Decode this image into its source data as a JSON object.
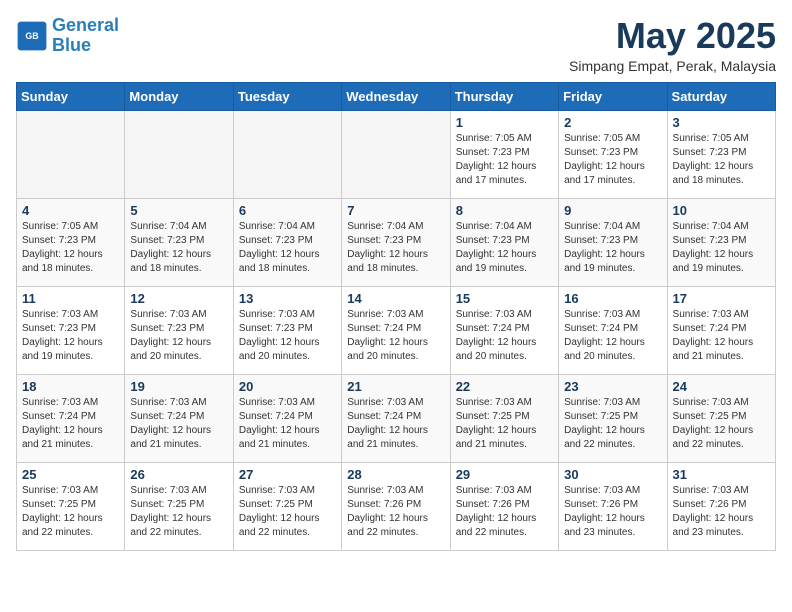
{
  "header": {
    "logo_line1": "General",
    "logo_line2": "Blue",
    "month_title": "May 2025",
    "subtitle": "Simpang Empat, Perak, Malaysia"
  },
  "weekdays": [
    "Sunday",
    "Monday",
    "Tuesday",
    "Wednesday",
    "Thursday",
    "Friday",
    "Saturday"
  ],
  "weeks": [
    [
      {
        "day": "",
        "info": ""
      },
      {
        "day": "",
        "info": ""
      },
      {
        "day": "",
        "info": ""
      },
      {
        "day": "",
        "info": ""
      },
      {
        "day": "1",
        "info": "Sunrise: 7:05 AM\nSunset: 7:23 PM\nDaylight: 12 hours\nand 17 minutes."
      },
      {
        "day": "2",
        "info": "Sunrise: 7:05 AM\nSunset: 7:23 PM\nDaylight: 12 hours\nand 17 minutes."
      },
      {
        "day": "3",
        "info": "Sunrise: 7:05 AM\nSunset: 7:23 PM\nDaylight: 12 hours\nand 18 minutes."
      }
    ],
    [
      {
        "day": "4",
        "info": "Sunrise: 7:05 AM\nSunset: 7:23 PM\nDaylight: 12 hours\nand 18 minutes."
      },
      {
        "day": "5",
        "info": "Sunrise: 7:04 AM\nSunset: 7:23 PM\nDaylight: 12 hours\nand 18 minutes."
      },
      {
        "day": "6",
        "info": "Sunrise: 7:04 AM\nSunset: 7:23 PM\nDaylight: 12 hours\nand 18 minutes."
      },
      {
        "day": "7",
        "info": "Sunrise: 7:04 AM\nSunset: 7:23 PM\nDaylight: 12 hours\nand 18 minutes."
      },
      {
        "day": "8",
        "info": "Sunrise: 7:04 AM\nSunset: 7:23 PM\nDaylight: 12 hours\nand 19 minutes."
      },
      {
        "day": "9",
        "info": "Sunrise: 7:04 AM\nSunset: 7:23 PM\nDaylight: 12 hours\nand 19 minutes."
      },
      {
        "day": "10",
        "info": "Sunrise: 7:04 AM\nSunset: 7:23 PM\nDaylight: 12 hours\nand 19 minutes."
      }
    ],
    [
      {
        "day": "11",
        "info": "Sunrise: 7:03 AM\nSunset: 7:23 PM\nDaylight: 12 hours\nand 19 minutes."
      },
      {
        "day": "12",
        "info": "Sunrise: 7:03 AM\nSunset: 7:23 PM\nDaylight: 12 hours\nand 20 minutes."
      },
      {
        "day": "13",
        "info": "Sunrise: 7:03 AM\nSunset: 7:23 PM\nDaylight: 12 hours\nand 20 minutes."
      },
      {
        "day": "14",
        "info": "Sunrise: 7:03 AM\nSunset: 7:24 PM\nDaylight: 12 hours\nand 20 minutes."
      },
      {
        "day": "15",
        "info": "Sunrise: 7:03 AM\nSunset: 7:24 PM\nDaylight: 12 hours\nand 20 minutes."
      },
      {
        "day": "16",
        "info": "Sunrise: 7:03 AM\nSunset: 7:24 PM\nDaylight: 12 hours\nand 20 minutes."
      },
      {
        "day": "17",
        "info": "Sunrise: 7:03 AM\nSunset: 7:24 PM\nDaylight: 12 hours\nand 21 minutes."
      }
    ],
    [
      {
        "day": "18",
        "info": "Sunrise: 7:03 AM\nSunset: 7:24 PM\nDaylight: 12 hours\nand 21 minutes."
      },
      {
        "day": "19",
        "info": "Sunrise: 7:03 AM\nSunset: 7:24 PM\nDaylight: 12 hours\nand 21 minutes."
      },
      {
        "day": "20",
        "info": "Sunrise: 7:03 AM\nSunset: 7:24 PM\nDaylight: 12 hours\nand 21 minutes."
      },
      {
        "day": "21",
        "info": "Sunrise: 7:03 AM\nSunset: 7:24 PM\nDaylight: 12 hours\nand 21 minutes."
      },
      {
        "day": "22",
        "info": "Sunrise: 7:03 AM\nSunset: 7:25 PM\nDaylight: 12 hours\nand 21 minutes."
      },
      {
        "day": "23",
        "info": "Sunrise: 7:03 AM\nSunset: 7:25 PM\nDaylight: 12 hours\nand 22 minutes."
      },
      {
        "day": "24",
        "info": "Sunrise: 7:03 AM\nSunset: 7:25 PM\nDaylight: 12 hours\nand 22 minutes."
      }
    ],
    [
      {
        "day": "25",
        "info": "Sunrise: 7:03 AM\nSunset: 7:25 PM\nDaylight: 12 hours\nand 22 minutes."
      },
      {
        "day": "26",
        "info": "Sunrise: 7:03 AM\nSunset: 7:25 PM\nDaylight: 12 hours\nand 22 minutes."
      },
      {
        "day": "27",
        "info": "Sunrise: 7:03 AM\nSunset: 7:25 PM\nDaylight: 12 hours\nand 22 minutes."
      },
      {
        "day": "28",
        "info": "Sunrise: 7:03 AM\nSunset: 7:26 PM\nDaylight: 12 hours\nand 22 minutes."
      },
      {
        "day": "29",
        "info": "Sunrise: 7:03 AM\nSunset: 7:26 PM\nDaylight: 12 hours\nand 22 minutes."
      },
      {
        "day": "30",
        "info": "Sunrise: 7:03 AM\nSunset: 7:26 PM\nDaylight: 12 hours\nand 23 minutes."
      },
      {
        "day": "31",
        "info": "Sunrise: 7:03 AM\nSunset: 7:26 PM\nDaylight: 12 hours\nand 23 minutes."
      }
    ]
  ]
}
